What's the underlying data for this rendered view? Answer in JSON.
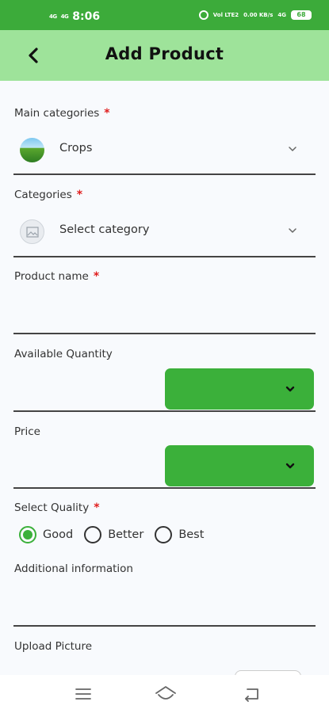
{
  "status_bar": {
    "net_left_1": "4G",
    "net_left_2": "4G",
    "time": "8:06",
    "net_right_lte": "Vol LTE2",
    "net_speed": "0.00 KB/s",
    "net_right_4g": "4G",
    "battery": "68"
  },
  "header": {
    "title": "Add Product"
  },
  "form": {
    "main_category": {
      "label": "Main categories",
      "required": "*",
      "value": "Crops"
    },
    "category": {
      "label": "Categories",
      "required": "*",
      "value": "Select category"
    },
    "product_name": {
      "label": "Product name",
      "required": "*",
      "value": ""
    },
    "available_quantity": {
      "label": "Available Quantity",
      "value": ""
    },
    "price": {
      "label": "Price",
      "value": ""
    },
    "quality": {
      "label": "Select Quality",
      "required": "*",
      "options": [
        "Good",
        "Better",
        "Best"
      ],
      "selected": "Good"
    },
    "additional_info": {
      "label": "Additional information",
      "value": ""
    },
    "upload": {
      "label": "Upload Picture"
    }
  },
  "colors": {
    "status_bar": "#3cab3a",
    "app_bar": "#9ee39a",
    "accent": "#3bb03a",
    "required": "#e01e1e"
  },
  "icons": {
    "back": "arrow-left-icon",
    "chevron": "chevron-down-icon",
    "nav_menu": "menu-icon",
    "nav_home": "home-icon",
    "nav_back": "back-icon"
  }
}
